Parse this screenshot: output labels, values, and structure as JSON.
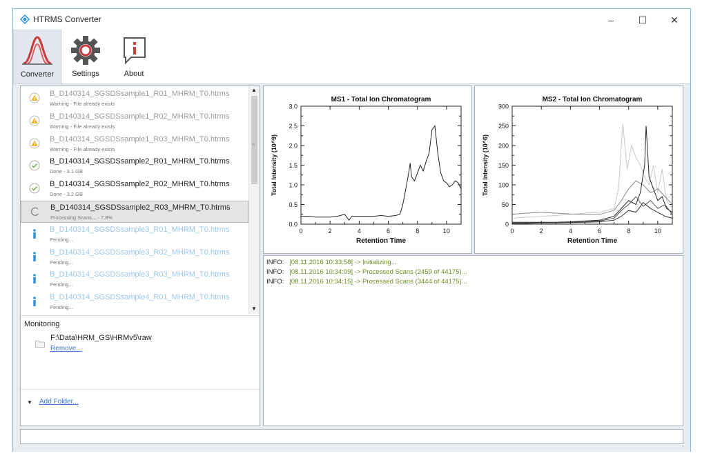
{
  "window": {
    "title": "HTRMS Converter",
    "minimize": "–",
    "maximize": "☐",
    "close": "✕"
  },
  "ribbon": [
    {
      "label": "Converter",
      "icon": "chromatogram-icon",
      "active": true
    },
    {
      "label": "Settings",
      "icon": "gear-icon",
      "active": false
    },
    {
      "label": "About",
      "icon": "info-speech-icon",
      "active": false
    }
  ],
  "files": [
    {
      "name": "B_D140314_SGSDSsample1_R01_MHRM_T0.htrms",
      "status": "Warning - File already exists",
      "state": "warning"
    },
    {
      "name": "B_D140314_SGSDSsample1_R02_MHRM_T0.htrms",
      "status": "Warning - File already exists",
      "state": "warning"
    },
    {
      "name": "B_D140314_SGSDSsample1_R03_MHRM_T0.htrms",
      "status": "Warning - File already exists",
      "state": "warning"
    },
    {
      "name": "B_D140314_SGSDSsample2_R01_MHRM_T0.htrms",
      "status": "Done - 3.1 GB",
      "state": "done"
    },
    {
      "name": "B_D140314_SGSDSsample2_R02_MHRM_T0.htrms",
      "status": "Done - 3.2 GB",
      "state": "done"
    },
    {
      "name": "B_D140314_SGSDSsample2_R03_MHRM_T0.htrms",
      "status": "Processing Scans... - 7.8%",
      "state": "processing"
    },
    {
      "name": "B_D140314_SGSDSsample3_R01_MHRM_T0.htrms",
      "status": "Pending...",
      "state": "pending"
    },
    {
      "name": "B_D140314_SGSDSsample3_R02_MHRM_T0.htrms",
      "status": "Pending...",
      "state": "pending"
    },
    {
      "name": "B_D140314_SGSDSsample3_R03_MHRM_T0.htrms",
      "status": "Pending...",
      "state": "pending"
    },
    {
      "name": "B_D140314_SGSDSsample4_R01_MHRM_T0.htrms",
      "status": "Pending...",
      "state": "pending"
    }
  ],
  "monitoring": {
    "title": "Monitoring",
    "path": "F:\\Data\\HRM_GS\\HRMv5\\raw",
    "remove_label": "Remove...",
    "add_folder_label": "Add Folder..."
  },
  "colors": {
    "warning": "#f2b21a",
    "done": "#76b35a",
    "pending": "#2d8fd8",
    "link": "#3a78d4",
    "log_green": "#6b8e23"
  },
  "log": [
    {
      "level": "INFO:",
      "text": "[08.11.2016 10:33:58] -> Initializing..."
    },
    {
      "level": "INFO:",
      "text": "[08.11.2016 10:34:09] -> Processed Scans (2459 of 44175)..."
    },
    {
      "level": "INFO:",
      "text": "[08.11.2016 10:34:15] -> Processed Scans (3444 of 44175)..."
    }
  ],
  "chart_data": [
    {
      "type": "line",
      "title": "MS1 - Total Ion Chromatogram",
      "xlabel": "Retention Time",
      "ylabel": "Total Intensity (10^9)",
      "xlim": [
        0,
        11
      ],
      "ylim": [
        0,
        3.0
      ],
      "xticks": [
        "0",
        "2",
        "4",
        "6",
        "8",
        "10"
      ],
      "yticks": [
        "0.0",
        "0.5",
        "1.0",
        "1.5",
        "2.0",
        "2.5",
        "3.0"
      ],
      "series": [
        {
          "color": "#222222",
          "x": [
            0,
            0.5,
            1,
            1.5,
            2,
            2.5,
            3,
            3.3,
            3.5,
            4,
            4.5,
            5,
            5.5,
            6,
            6.5,
            6.8,
            7.0,
            7.2,
            7.4,
            7.5,
            7.6,
            7.8,
            8.0,
            8.2,
            8.4,
            8.6,
            8.8,
            9.0,
            9.2,
            9.4,
            9.6,
            9.8,
            10.0,
            10.2,
            10.4,
            10.6,
            10.8,
            11
          ],
          "y": [
            0.2,
            0.2,
            0.18,
            0.18,
            0.18,
            0.2,
            0.25,
            0.1,
            0.2,
            0.2,
            0.2,
            0.2,
            0.22,
            0.2,
            0.22,
            0.25,
            0.5,
            0.9,
            1.3,
            1.55,
            1.2,
            1.1,
            1.3,
            1.5,
            1.35,
            1.6,
            1.8,
            2.4,
            2.5,
            1.8,
            1.3,
            1.1,
            1.05,
            0.95,
            1.0,
            1.1,
            1.05,
            0.9
          ]
        }
      ]
    },
    {
      "type": "line",
      "title": "MS2 - Total Ion Chromatogram",
      "xlabel": "Retention Time",
      "ylabel": "Total Intensity (10^6)",
      "xlim": [
        0,
        11
      ],
      "ylim": [
        0,
        300
      ],
      "xticks": [
        "0",
        "2",
        "4",
        "6",
        "8",
        "10"
      ],
      "yticks": [
        "0",
        "50",
        "100",
        "150",
        "200",
        "250",
        "300"
      ],
      "series": [
        {
          "color": "#c8c8c8",
          "x": [
            0,
            1,
            2,
            3,
            4,
            5,
            6,
            7,
            7.3,
            7.6,
            7.9,
            8.2,
            8.5,
            8.8,
            9.1,
            9.4,
            9.7,
            10.0,
            10.3,
            10.6,
            11
          ],
          "y": [
            15,
            18,
            20,
            22,
            25,
            28,
            30,
            40,
            90,
            255,
            140,
            200,
            170,
            150,
            120,
            100,
            150,
            80,
            140,
            60,
            40
          ]
        },
        {
          "color": "#888888",
          "x": [
            0,
            1,
            2,
            3,
            4,
            5,
            6,
            7,
            7.5,
            8,
            8.5,
            9,
            9.5,
            10,
            10.5,
            11
          ],
          "y": [
            25,
            28,
            30,
            28,
            26,
            25,
            25,
            35,
            60,
            90,
            110,
            100,
            80,
            90,
            70,
            50
          ]
        },
        {
          "color": "#222222",
          "x": [
            0,
            1,
            2,
            3,
            4,
            5,
            6,
            7,
            7.5,
            8,
            8.5,
            8.8,
            9.1,
            9.2,
            9.4,
            9.7,
            10,
            10.3,
            10.6,
            11
          ],
          "y": [
            5,
            5,
            5,
            5,
            6,
            8,
            10,
            20,
            40,
            60,
            50,
            80,
            150,
            250,
            120,
            90,
            60,
            70,
            40,
            30
          ]
        },
        {
          "color": "#555555",
          "x": [
            0,
            1,
            2,
            3,
            4,
            5,
            6,
            7,
            7.5,
            8,
            8.5,
            9,
            9.5,
            10,
            10.5,
            11
          ],
          "y": [
            3,
            3,
            4,
            4,
            5,
            6,
            8,
            15,
            35,
            50,
            70,
            45,
            60,
            40,
            50,
            25
          ]
        },
        {
          "color": "#333333",
          "x": [
            0,
            1,
            2,
            3,
            4,
            5,
            6,
            7,
            7.5,
            8,
            8.5,
            9,
            9.5,
            10,
            10.5,
            11
          ],
          "y": [
            2,
            2,
            3,
            3,
            4,
            5,
            6,
            10,
            20,
            35,
            30,
            55,
            40,
            30,
            20,
            15
          ]
        }
      ]
    }
  ]
}
